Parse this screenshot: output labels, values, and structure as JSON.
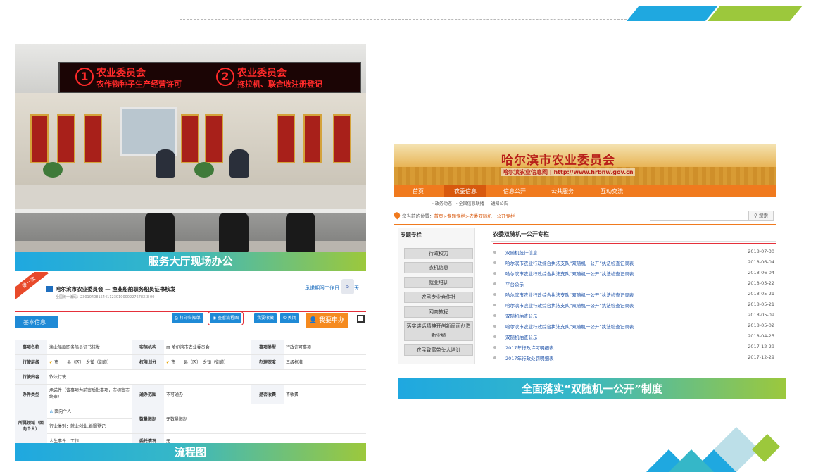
{
  "photo": {
    "led_sign": [
      {
        "num": "1",
        "line1": "农业委员会",
        "line2": "农作物种子生产经营许可"
      },
      {
        "num": "2",
        "line1": "农业委员会",
        "line2": "拖拉机、联合收注册登记"
      }
    ],
    "caption": "服务大厅现场办公"
  },
  "flowchart": {
    "ribbon": "第一次",
    "title": "哈尔滨市农业委员会 — 渔业船舶职务船员证书核发",
    "code": "全国统一编码：2301040815441123010000227678X-3-00",
    "deadline_label": "承诺期限工作日",
    "deadline_days": "5",
    "deadline_unit": "天",
    "info_tab": "基本信息",
    "buttons": {
      "print": "打印告知单",
      "view_flow": "查看流程图",
      "favorite": "我要收藏",
      "close": "关闭",
      "apply": "我要申办"
    },
    "rows": [
      {
        "k1": "事项名称",
        "v1": "渔业船舶职务船员证书核发",
        "k2": "实施机构",
        "v2": "哈尔滨市农业委员会",
        "k3": "事项类型",
        "v3": "行政许可事项"
      },
      {
        "k1": "行使层级",
        "v1": "市　　县（区）　乡镇（街道）",
        "k2": "权限划分",
        "v2": "市　　县（区）　乡镇（街道）",
        "k3": "办理深度",
        "v3": "三级标准"
      },
      {
        "k1": "行使内容",
        "v1": "依法行使",
        "k2": "",
        "v2": "",
        "k3": "",
        "v3": ""
      },
      {
        "k1": "办件类型",
        "v1": "承诺件（该事项为前审后批事项，市初审市终审）",
        "k2": "通办范围",
        "v2": "不可通办",
        "k3": "是否收费",
        "v3": "不收费"
      },
      {
        "k1": "所属领域（面向个人）",
        "v1": "面向个人",
        "k2": "数量限制",
        "v2": "无数量限制",
        "k3": "",
        "v3": ""
      },
      {
        "k1": "",
        "v1": "行业类别：就业创业,婚姻登记",
        "k2": "",
        "v2": "",
        "k3": "",
        "v3": ""
      },
      {
        "k1": "",
        "v1": "人生事件：工作",
        "k2": "委托情况",
        "v2": "无",
        "k3": "",
        "v3": ""
      }
    ],
    "caption": "流程图"
  },
  "website": {
    "site_title": "哈尔滨市农业委员会",
    "site_sub": "哈尔滨农业信息网 | http://www.hrbnw.gov.cn",
    "nav": [
      "首页",
      "农委信息",
      "信息公开",
      "公共服务",
      "互动交流"
    ],
    "nav_active": 1,
    "subnav": "· 政务动态　· 全国信息联播　· 通知公告",
    "location_label": "您当前的位置：",
    "location_path": "首页>专题专栏>农委双随机一公开专栏",
    "search_button": "搜索",
    "sidebar_title": "专题专栏",
    "sidebar_items": [
      "行政权力",
      "农机信息",
      "就业培训",
      "农民专业合作社",
      "网商教程",
      "落实讲话精神开创新局面创造新业绩",
      "农民致富带头人培训"
    ],
    "main_title": "农委双随机一公开专栏",
    "news": [
      {
        "title": "双随机统计信息",
        "date": "2018-07-30"
      },
      {
        "title": "哈尔滨市农业行政综合执法支队“双随机一公开”执法检查记录表",
        "date": "2018-06-04"
      },
      {
        "title": "哈尔滨市农业行政综合执法支队“双随机一公开”执法检查记录表",
        "date": "2018-06-04"
      },
      {
        "title": "平台公示",
        "date": "2018-05-22"
      },
      {
        "title": "哈尔滨市农业行政综合执法支队“双随机一公开”执法检查记录表",
        "date": "2018-05-21"
      },
      {
        "title": "哈尔滨市农业行政综合执法支队“双随机一公开”执法检查记录表",
        "date": "2018-05-21"
      },
      {
        "title": "双随机抽查公示",
        "date": "2018-05-09"
      },
      {
        "title": "哈尔滨市农业行政综合执法支队“双随机一公开”执法检查记录表",
        "date": "2018-05-02"
      },
      {
        "title": "双随机抽查公示",
        "date": "2018-04-25"
      },
      {
        "title": "2017年行政许可明细表",
        "date": "2017-12-29"
      },
      {
        "title": "2017年行政处罚明细表",
        "date": "2017-12-29"
      }
    ],
    "caption": "全面落实“双随机一公开”制度"
  },
  "colors": {
    "accent_blue": "#1fa8e0",
    "accent_green": "#9cc83c",
    "highlight_red": "#e5303a",
    "site_orange": "#f07a1e"
  }
}
